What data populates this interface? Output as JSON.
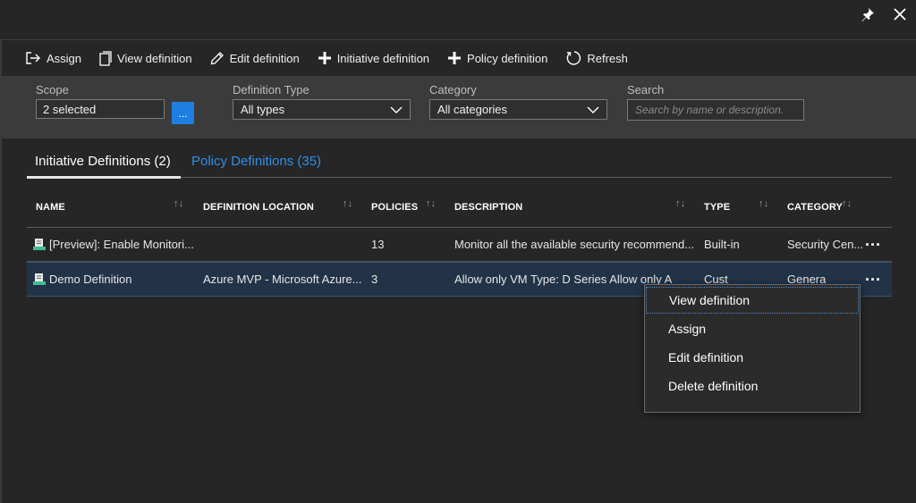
{
  "window": {
    "pin_icon": "pin-icon",
    "close_icon": "close-icon"
  },
  "toolbar": {
    "assign": "Assign",
    "view_definition": "View definition",
    "edit_definition": "Edit definition",
    "initiative_definition": "Initiative definition",
    "policy_definition": "Policy definition",
    "refresh": "Refresh"
  },
  "filters": {
    "scope": {
      "label": "Scope",
      "value": "2 selected",
      "button": "..."
    },
    "definition_type": {
      "label": "Definition Type",
      "value": "All types"
    },
    "category": {
      "label": "Category",
      "value": "All categories"
    },
    "search": {
      "label": "Search",
      "placeholder": "Search by name or description."
    }
  },
  "tabs": [
    {
      "label": "Initiative Definitions (2)",
      "active": true
    },
    {
      "label": "Policy Definitions (35)",
      "active": false
    }
  ],
  "table": {
    "columns": [
      "NAME",
      "DEFINITION LOCATION",
      "POLICIES",
      "DESCRIPTION",
      "TYPE",
      "CATEGORY"
    ],
    "rows": [
      {
        "name": "[Preview]: Enable Monitori...",
        "location": "",
        "policies": "13",
        "description": "Monitor all the available security recommend...",
        "type": "Built-in",
        "category": "Security Cen...",
        "more": "..."
      },
      {
        "name": "Demo Definition",
        "location": "Azure MVP - Microsoft Azure...",
        "policies": "3",
        "description": "Allow only VM Type: D Series Allow only A",
        "type": "Cust",
        "category": "Genera",
        "more": "...",
        "selected": true
      }
    ]
  },
  "context_menu": {
    "items": [
      "View definition",
      "Assign",
      "Edit definition",
      "Delete definition"
    ]
  },
  "colors": {
    "accent": "#1f7fe0",
    "link": "#2e8fe8",
    "background": "#262626",
    "filter_bar": "#3b3b3b"
  }
}
